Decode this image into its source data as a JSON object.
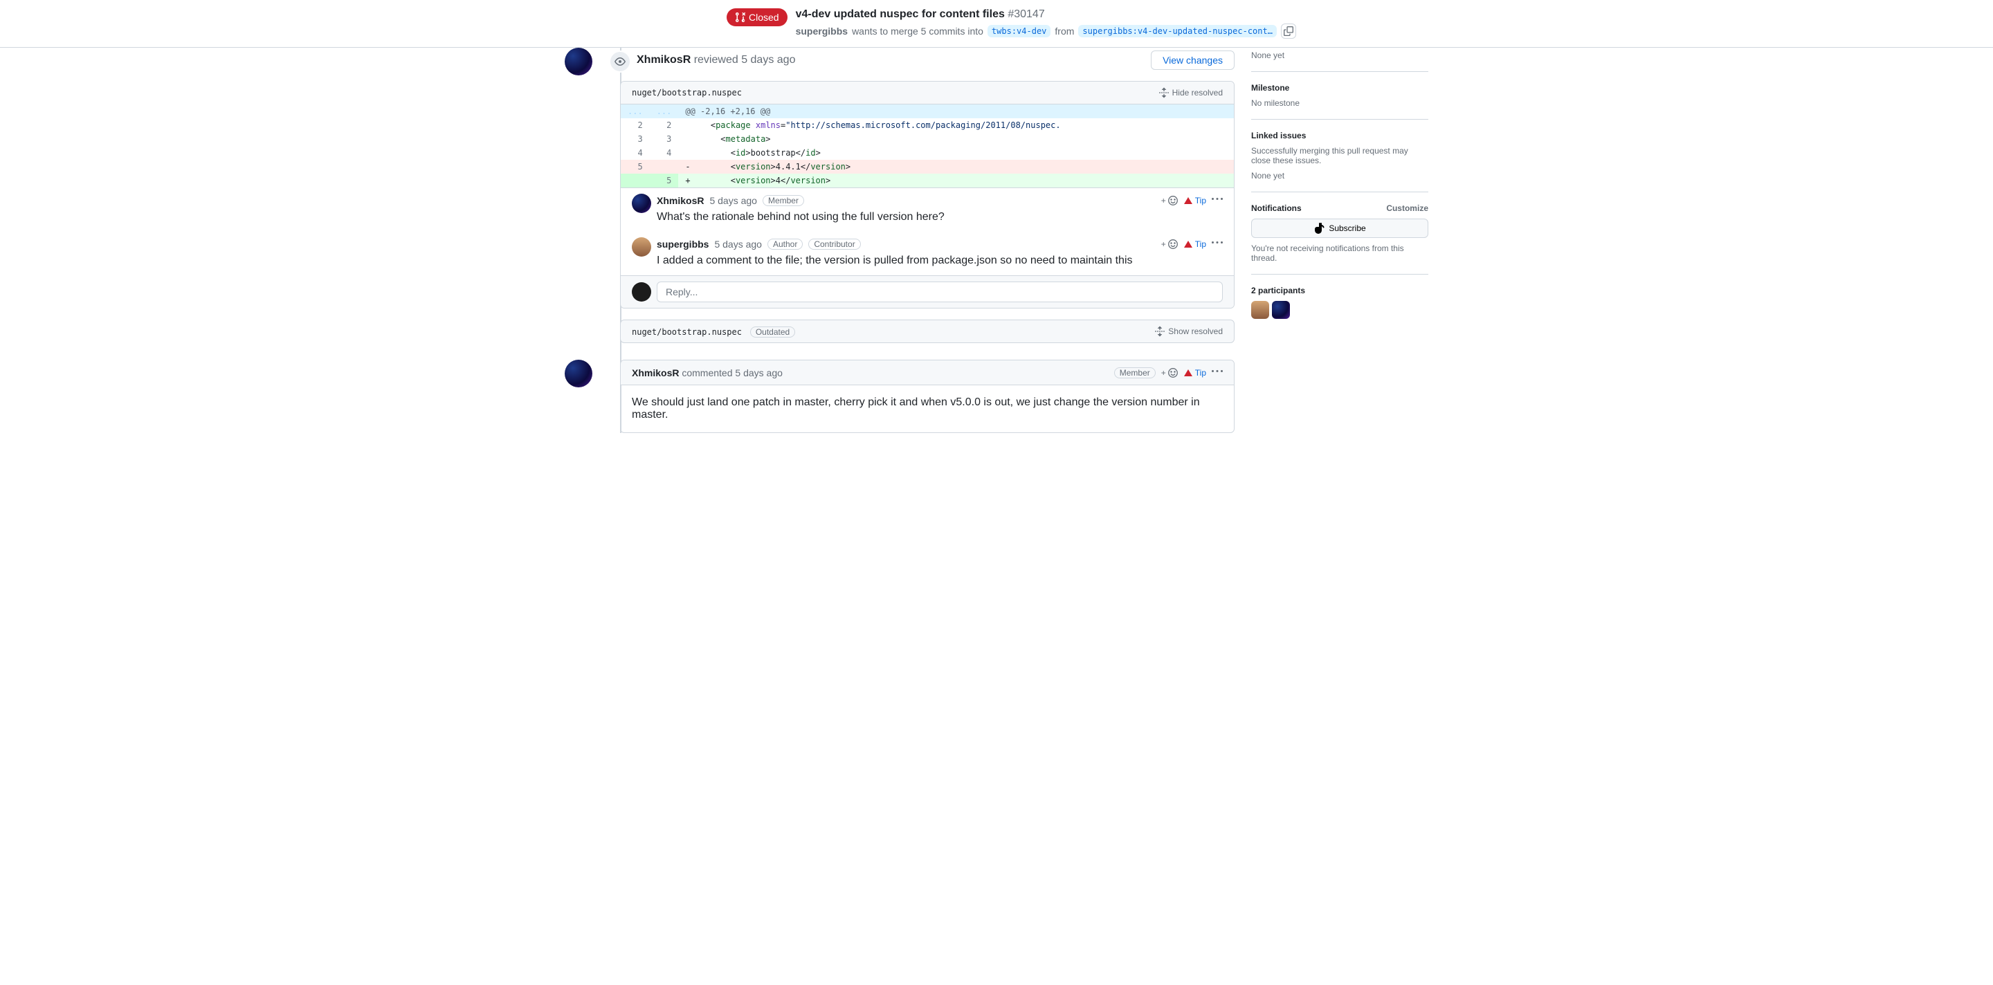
{
  "header": {
    "state": "Closed",
    "title": "v4-dev updated nuspec for content files",
    "issue_number": "#30147",
    "author": "supergibbs",
    "merge_text_1": "wants to merge 5 commits into",
    "base_branch": "twbs:v4-dev",
    "from_text": "from",
    "head_branch": "supergibbs:v4-dev-updated-nuspec-cont…"
  },
  "review": {
    "user": "XhmikosR",
    "action": "reviewed",
    "time": "5 days ago",
    "view_changes": "View changes",
    "file_path": "nuget/bootstrap.nuspec",
    "hide_resolved": "Hide resolved",
    "hunk": "@@ -2,16 +2,16 @@",
    "comments": [
      {
        "user": "XhmikosR",
        "time": "5 days ago",
        "labels": [
          "Member"
        ],
        "text": "What's the rationale behind not using the full version here?",
        "tip": "Tip"
      },
      {
        "user": "supergibbs",
        "time": "5 days ago",
        "labels": [
          "Author",
          "Contributor"
        ],
        "text": "I added a comment to the file; the version is pulled from package.json so no need to maintain this",
        "tip": "Tip"
      }
    ],
    "reply_placeholder": "Reply..."
  },
  "resolved_file": {
    "path": "nuget/bootstrap.nuspec",
    "outdated": "Outdated",
    "show_resolved": "Show resolved"
  },
  "comment": {
    "user": "XhmikosR",
    "action": "commented",
    "time": "5 days ago",
    "label": "Member",
    "tip": "Tip",
    "body": "We should just land one patch in master, cherry pick it and when v5.0.0 is out, we just change the version number in master."
  },
  "sidebar": {
    "none_yet": "None yet",
    "milestone_title": "Milestone",
    "milestone_text": "No milestone",
    "linked_title": "Linked issues",
    "linked_text": "Successfully merging this pull request may close these issues.",
    "linked_none": "None yet",
    "notifications_title": "Notifications",
    "customize": "Customize",
    "subscribe": "Subscribe",
    "notif_text": "You're not receiving notifications from this thread.",
    "participants_title": "2 participants"
  }
}
